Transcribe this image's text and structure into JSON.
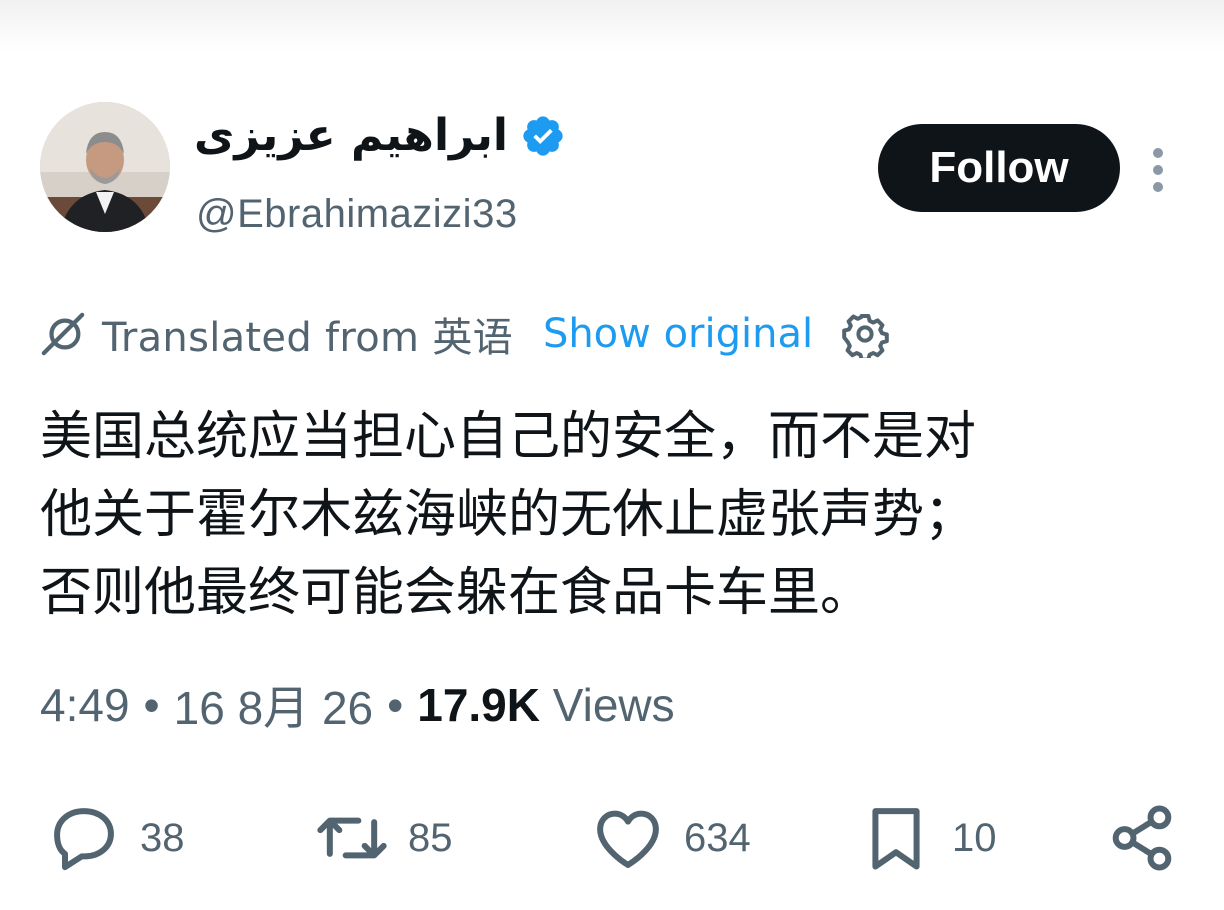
{
  "author": {
    "display_name": "ابراهیم عزیزی",
    "handle": "@Ebrahimazizi33",
    "verified": true
  },
  "follow_label": "Follow",
  "translation": {
    "label": "Translated from 英语",
    "show_original": "Show original"
  },
  "tweet": {
    "text": "美国总统应当担心自己的安全，而不是对\n他关于霍尔木兹海峡的无休止虚张声势；\n否则他最终可能会躲在食品卡车里。"
  },
  "meta": {
    "time": "4:49",
    "separator": "•",
    "date": "16 8月 26",
    "views_count": "17.9K",
    "views_label": " Views"
  },
  "actions": {
    "reply_count": "38",
    "retweet_count": "85",
    "like_count": "634",
    "bookmark_count": "10"
  },
  "colors": {
    "accent": "#1d9bf0",
    "text_primary": "#0f1419",
    "text_secondary": "#536471"
  },
  "icons": [
    "avatar",
    "verified-badge-icon",
    "more-options-icon",
    "translate-icon",
    "gear-icon",
    "reply-icon",
    "retweet-icon",
    "like-icon",
    "bookmark-icon",
    "share-icon"
  ]
}
